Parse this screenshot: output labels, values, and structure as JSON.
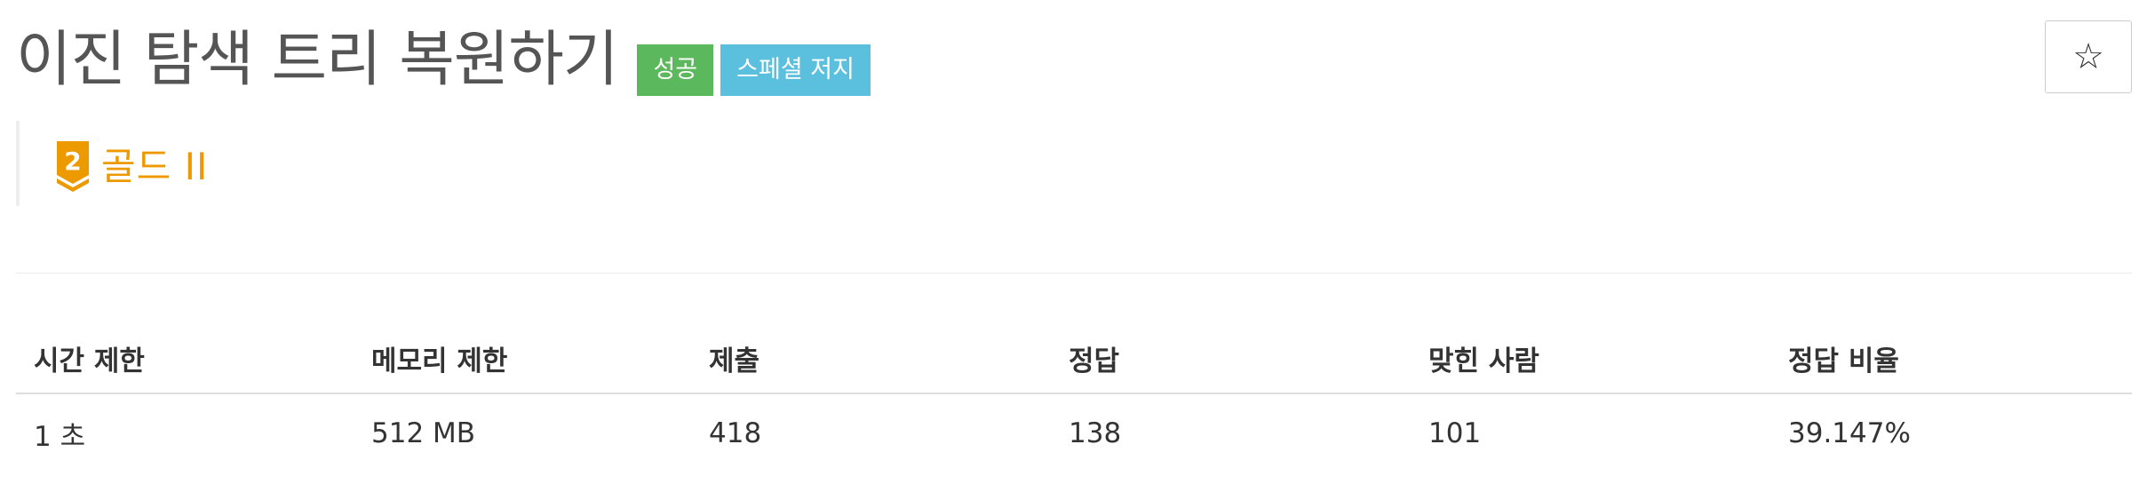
{
  "problem": {
    "title": "이진 탐색 트리 복원하기",
    "badges": {
      "success": "성공",
      "special_judge": "스페셜 저지"
    },
    "star_icon": "☆",
    "tier": {
      "icon_number": "2",
      "label": "골드 II",
      "color": "#ec9a00"
    }
  },
  "stats": {
    "headers": {
      "time_limit": "시간 제한",
      "memory_limit": "메모리 제한",
      "submissions": "제출",
      "accepted": "정답",
      "solvers": "맞힌 사람",
      "ratio": "정답 비율"
    },
    "values": {
      "time_limit": "1 초",
      "memory_limit": "512 MB",
      "submissions": "418",
      "accepted": "138",
      "solvers": "101",
      "ratio": "39.147%"
    }
  },
  "colors": {
    "success": "#5cb85c",
    "info": "#5bc0de",
    "tier_gold": "#ec9a00"
  }
}
